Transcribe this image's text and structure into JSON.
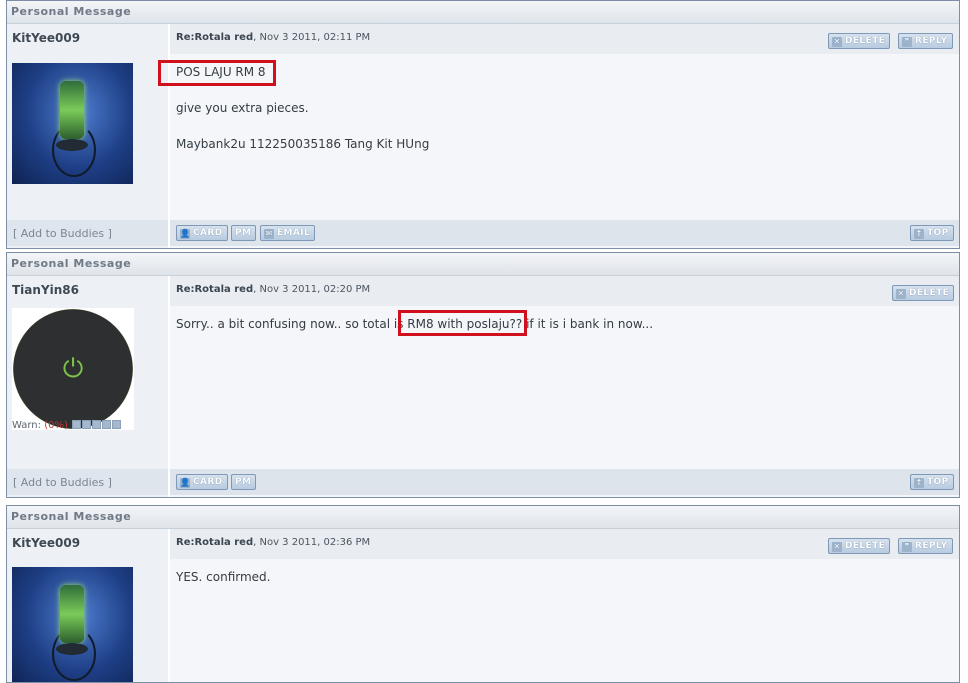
{
  "posts": [
    {
      "header": "Personal Message",
      "username": "KitYee009",
      "subject": "Re:Rotala red",
      "timestamp": ", Nov 3 2011, 02:11 PM",
      "lines": [
        "POS LAJU RM 8",
        "give you extra pieces.",
        "Maybank2u 112250035186 Tang Kit HUng"
      ],
      "buttons": {
        "delete": "DELETE",
        "reply": "REPLY",
        "card": "CARD",
        "pm": "PM",
        "email": "EMAIL",
        "top": "TOP"
      },
      "add_buddies": "[ Add to Buddies ]"
    },
    {
      "header": "Personal Message",
      "username": "TianYin86",
      "subject": "Re:Rotala red",
      "timestamp": ", Nov 3 2011, 02:20 PM",
      "line_before": "Sorry.. a bit confusing now.. so total is",
      "line_highlight": " RM8 with poslaju??",
      "line_after": " if it is i bank in now...",
      "warn_label": "Warn:",
      "warn_pct": "(0%)",
      "buttons": {
        "delete": "DELETE",
        "card": "CARD",
        "pm": "PM",
        "top": "TOP"
      },
      "add_buddies": "[ Add to Buddies ]"
    },
    {
      "header": "Personal Message",
      "username": "KitYee009",
      "subject": "Re:Rotala red",
      "timestamp": ", Nov 3 2011, 02:36 PM",
      "lines": [
        "YES. confirmed."
      ],
      "buttons": {
        "delete": "DELETE",
        "reply": "REPLY"
      }
    }
  ],
  "colors": {
    "highlight": "#d0101c",
    "header_text": "#6f7a86",
    "button": "#b8cbe0"
  },
  "icons": [
    "delete-x-icon",
    "reply-quote-icon",
    "card-person-icon",
    "email-envelope-icon",
    "top-arrow-icon",
    "power-icon"
  ]
}
